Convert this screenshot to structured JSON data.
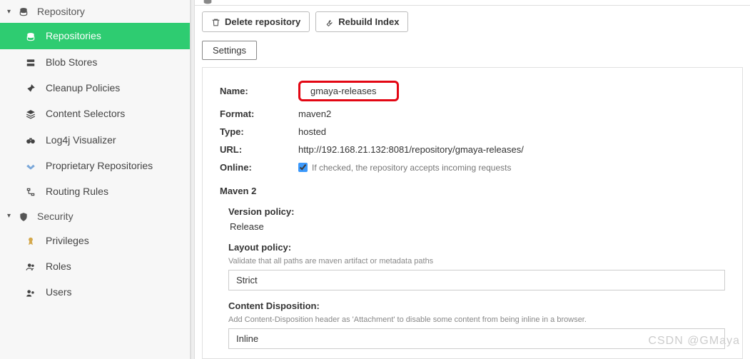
{
  "sidebar": {
    "groups": [
      {
        "label": "Repository",
        "items": [
          {
            "label": "Repositories",
            "icon": "database-icon",
            "active": true
          },
          {
            "label": "Blob Stores",
            "icon": "server-icon"
          },
          {
            "label": "Cleanup Policies",
            "icon": "brush-icon"
          },
          {
            "label": "Content Selectors",
            "icon": "layers-icon"
          },
          {
            "label": "Log4j Visualizer",
            "icon": "binoculars-icon"
          },
          {
            "label": "Proprietary Repositories",
            "icon": "handshake-icon"
          },
          {
            "label": "Routing Rules",
            "icon": "route-icon"
          }
        ]
      },
      {
        "label": "Security",
        "items": [
          {
            "label": "Privileges",
            "icon": "ribbon-icon"
          },
          {
            "label": "Roles",
            "icon": "users-icon"
          },
          {
            "label": "Users",
            "icon": "user-group-icon"
          }
        ]
      }
    ]
  },
  "toolbar": {
    "delete_label": "Delete repository",
    "rebuild_label": "Rebuild Index",
    "settings_label": "Settings"
  },
  "details": {
    "rows": {
      "name": {
        "label": "Name:",
        "value": "gmaya-releases"
      },
      "format": {
        "label": "Format:",
        "value": "maven2"
      },
      "type": {
        "label": "Type:",
        "value": "hosted"
      },
      "url": {
        "label": "URL:",
        "value": "http://192.168.21.132:8081/repository/gmaya-releases/"
      },
      "online": {
        "label": "Online:",
        "checked": true,
        "hint": "If checked, the repository accepts incoming requests"
      }
    },
    "maven2": {
      "title": "Maven 2",
      "version_policy": {
        "label": "Version policy:",
        "value": "Release"
      },
      "layout_policy": {
        "label": "Layout policy:",
        "hint": "Validate that all paths are maven artifact or metadata paths",
        "value": "Strict"
      },
      "content_disposition": {
        "label": "Content Disposition:",
        "hint": "Add Content-Disposition header as 'Attachment' to disable some content from being inline in a browser.",
        "value": "Inline"
      }
    }
  },
  "watermark": "CSDN @GMaya"
}
